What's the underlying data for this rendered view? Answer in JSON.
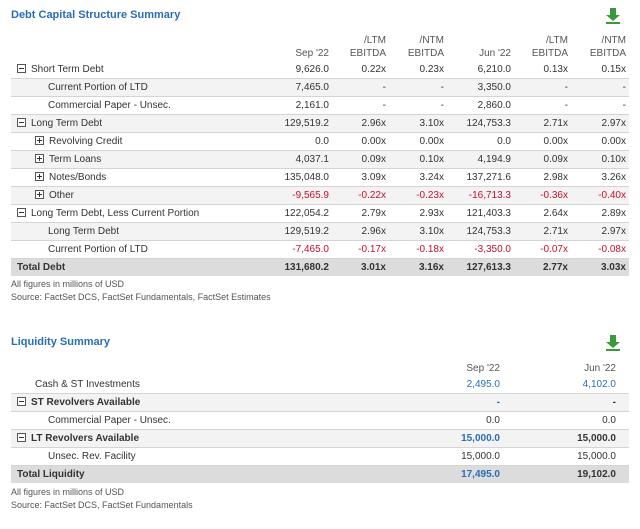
{
  "debt": {
    "title": "Debt Capital Structure Summary",
    "headers": [
      {
        "l1": "",
        "l2": "Sep '22"
      },
      {
        "l1": "/LTM",
        "l2": "EBITDA"
      },
      {
        "l1": "/NTM",
        "l2": "EBITDA"
      },
      {
        "l1": "",
        "l2": "Jun '22"
      },
      {
        "l1": "/LTM",
        "l2": "EBITDA"
      },
      {
        "l1": "/NTM",
        "l2": "EBITDA"
      }
    ],
    "rows": [
      {
        "label": "Short Term Debt",
        "toggle": "minus",
        "indent": 0,
        "values": [
          "9,626.0",
          "0.22x",
          "0.23x",
          "6,210.0",
          "0.13x",
          "0.15x"
        ]
      },
      {
        "label": "Current Portion of LTD",
        "toggle": "",
        "indent": 2,
        "values": [
          "7,465.0",
          "-",
          "-",
          "3,350.0",
          "-",
          "-"
        ]
      },
      {
        "label": "Commercial Paper - Unsec.",
        "toggle": "",
        "indent": 2,
        "values": [
          "2,161.0",
          "-",
          "-",
          "2,860.0",
          "-",
          "-"
        ]
      },
      {
        "label": "Long Term Debt",
        "toggle": "minus",
        "indent": 0,
        "values": [
          "129,519.2",
          "2.96x",
          "3.10x",
          "124,753.3",
          "2.71x",
          "2.97x"
        ]
      },
      {
        "label": "Revolving Credit",
        "toggle": "plus",
        "indent": 1,
        "values": [
          "0.0",
          "0.00x",
          "0.00x",
          "0.0",
          "0.00x",
          "0.00x"
        ]
      },
      {
        "label": "Term Loans",
        "toggle": "plus",
        "indent": 1,
        "values": [
          "4,037.1",
          "0.09x",
          "0.10x",
          "4,194.9",
          "0.09x",
          "0.10x"
        ]
      },
      {
        "label": "Notes/Bonds",
        "toggle": "plus",
        "indent": 1,
        "values": [
          "135,048.0",
          "3.09x",
          "3.24x",
          "137,271.6",
          "2.98x",
          "3.26x"
        ]
      },
      {
        "label": "Other",
        "toggle": "plus",
        "indent": 1,
        "values": [
          "-9,565.9",
          "-0.22x",
          "-0.23x",
          "-16,713.3",
          "-0.36x",
          "-0.40x"
        ]
      },
      {
        "label": "Long Term Debt, Less Current Portion",
        "toggle": "minus",
        "indent": 0,
        "values": [
          "122,054.2",
          "2.79x",
          "2.93x",
          "121,403.3",
          "2.64x",
          "2.89x"
        ]
      },
      {
        "label": "Long Term Debt",
        "toggle": "",
        "indent": 2,
        "values": [
          "129,519.2",
          "2.96x",
          "3.10x",
          "124,753.3",
          "2.71x",
          "2.97x"
        ]
      },
      {
        "label": "Current Portion of LTD",
        "toggle": "",
        "indent": 2,
        "values": [
          "-7,465.0",
          "-0.17x",
          "-0.18x",
          "-3,350.0",
          "-0.07x",
          "-0.08x"
        ]
      }
    ],
    "total": {
      "label": "Total Debt",
      "values": [
        "131,680.2",
        "3.01x",
        "3.16x",
        "127,613.3",
        "2.77x",
        "3.03x"
      ]
    },
    "footnote1": "All figures in millions of USD",
    "footnote2": "Source: FactSet DCS, FactSet Fundamentals, FactSet Estimates"
  },
  "liquidity": {
    "title": "Liquidity Summary",
    "headers": [
      "Sep '22",
      "Jun '22"
    ],
    "rows": [
      {
        "label": "Cash & ST Investments",
        "toggle": "",
        "indent": 1,
        "bold": false,
        "values": [
          "2,495.0",
          "4,102.0"
        ],
        "blue": [
          true,
          true
        ]
      },
      {
        "label": "ST Revolvers Available",
        "toggle": "minus",
        "indent": 0,
        "bold": true,
        "values": [
          "-",
          "-"
        ],
        "blue": [
          true,
          false
        ]
      },
      {
        "label": "Commercial Paper - Unsec.",
        "toggle": "",
        "indent": 2,
        "bold": false,
        "values": [
          "0.0",
          "0.0"
        ],
        "blue": [
          false,
          false
        ]
      },
      {
        "label": "LT Revolvers Available",
        "toggle": "minus",
        "indent": 0,
        "bold": true,
        "values": [
          "15,000.0",
          "15,000.0"
        ],
        "blue": [
          true,
          false
        ]
      },
      {
        "label": "Unsec. Rev. Facility",
        "toggle": "",
        "indent": 2,
        "bold": false,
        "values": [
          "15,000.0",
          "15,000.0"
        ],
        "blue": [
          false,
          false
        ]
      }
    ],
    "total": {
      "label": "Total Liquidity",
      "values": [
        "17,495.0",
        "19,102.0"
      ],
      "blue": [
        true,
        false
      ]
    },
    "footnote1": "All figures in millions of USD",
    "footnote2": "Source: FactSet DCS, FactSet Fundamentals"
  },
  "icons": {
    "download": "download-arrow-icon",
    "accent": "#2a6db5",
    "icon_green": "#3a9a3a",
    "negative": "#c8102e"
  }
}
